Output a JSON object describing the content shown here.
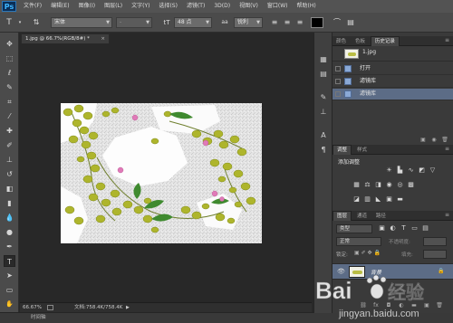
{
  "menubar": {
    "logo": "Ps",
    "items": [
      "文件(F)",
      "编辑(E)",
      "图像(I)",
      "图层(L)",
      "文字(Y)",
      "选择(S)",
      "滤镜(T)",
      "3D(D)",
      "视图(V)",
      "窗口(W)",
      "帮助(H)"
    ]
  },
  "options": {
    "font_family": "宋体",
    "font_size": "48 点",
    "antialias": "锐利"
  },
  "document": {
    "tab_title": "1.jpg @ 66.7%(RGB/8#) *",
    "zoom": "66.67%",
    "doc_size": "文档:758.4K/758.4K"
  },
  "bottom_tab": "时间轴",
  "history_panel": {
    "tabs": [
      "颜色",
      "色板",
      "历史记录"
    ],
    "snapshot_name": "1.jpg",
    "steps": [
      "打开",
      "滤镜库",
      "滤镜库"
    ]
  },
  "adjust_panel": {
    "tabs": [
      "调整",
      "样式"
    ],
    "title": "添加调整"
  },
  "layers_panel": {
    "tabs": [
      "图层",
      "通道",
      "路径"
    ],
    "filter_kind": "类型",
    "blend_mode": "正常",
    "opacity_label": "不透明度:",
    "lock_label": "锁定:",
    "fill_label": "填充:",
    "layer_name": "背景"
  },
  "watermark": {
    "brand": "Bai",
    "brand2": "经验",
    "url": "jingyan.baidu.com"
  }
}
